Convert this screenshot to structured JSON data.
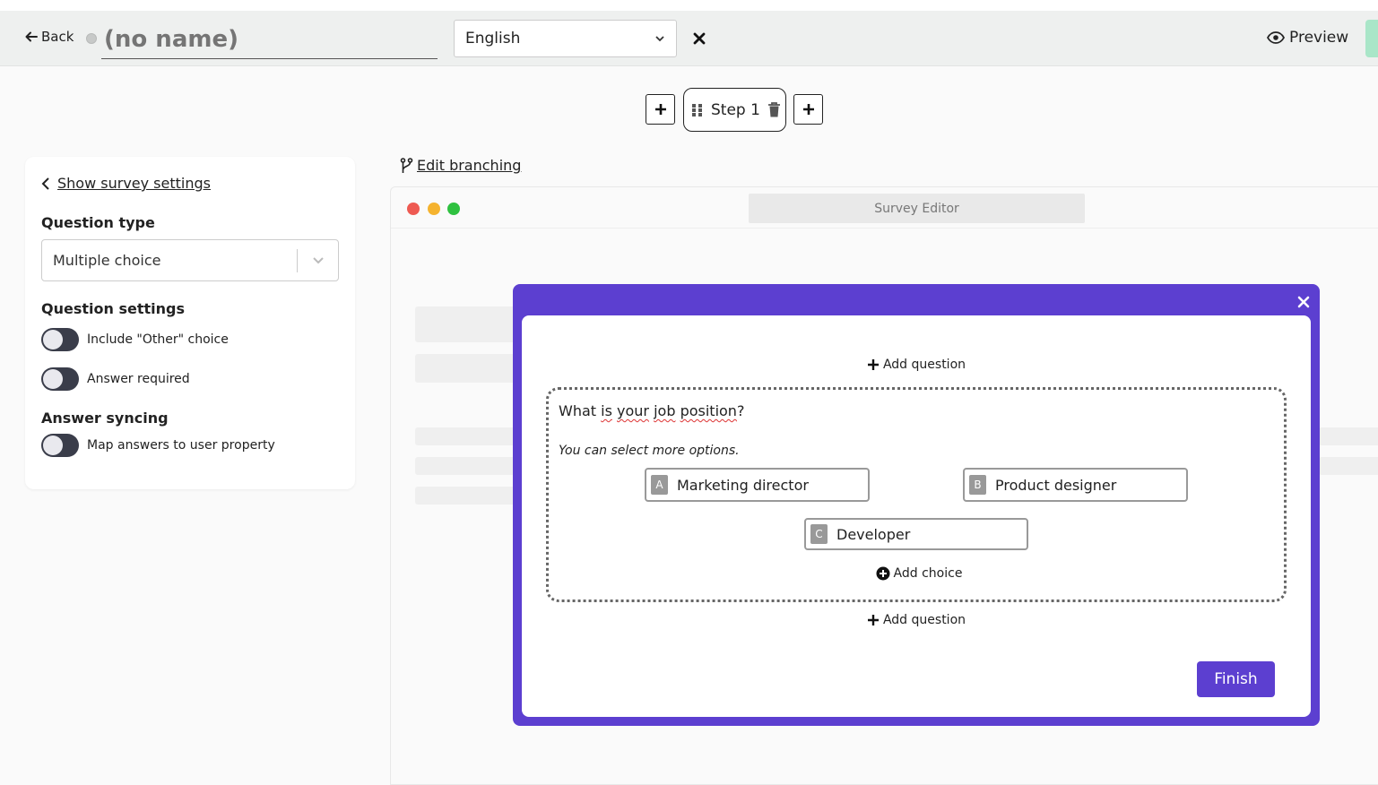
{
  "header": {
    "back_label": "Back",
    "name_placeholder": "(no name)",
    "language": "English",
    "preview_label": "Preview"
  },
  "steps": {
    "current_label": "Step 1"
  },
  "sidebar": {
    "show_settings_label": "Show survey settings",
    "question_type_title": "Question type",
    "question_type_value": "Multiple choice",
    "question_settings_title": "Question settings",
    "include_other_label": "Include \"Other\" choice",
    "answer_required_label": "Answer required",
    "answer_syncing_title": "Answer syncing",
    "map_answers_label": "Map answers to user property"
  },
  "editor": {
    "edit_branching_label": "Edit branching",
    "browser_title": "Survey Editor"
  },
  "modal": {
    "add_question_label": "Add question",
    "question_words": [
      "What ",
      "is",
      " ",
      "your",
      " ",
      "job",
      " ",
      "position",
      "?"
    ],
    "hint": "You can select more options.",
    "choices": [
      {
        "letter": "A",
        "label": "Marketing director"
      },
      {
        "letter": "B",
        "label": "Product designer"
      },
      {
        "letter": "C",
        "label": "Developer"
      }
    ],
    "add_choice_label": "Add choice",
    "finish_label": "Finish"
  },
  "colors": {
    "modal_accent": "#5c3fd0",
    "toggle_off": "#3a3d4a",
    "dot_red": "#ee5a52",
    "dot_yellow": "#f5b32f",
    "dot_green": "#2fc140"
  }
}
